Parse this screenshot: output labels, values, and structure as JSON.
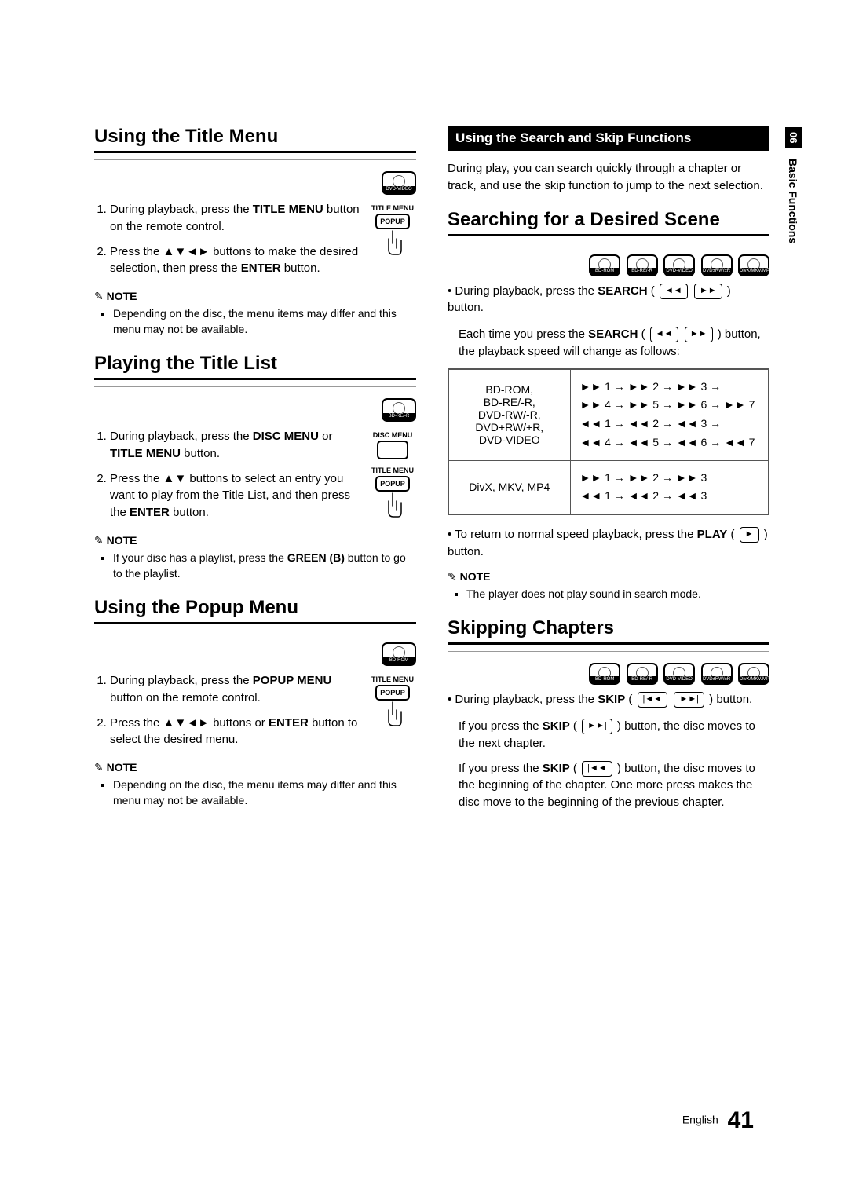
{
  "sideTab": {
    "num": "06",
    "label": "Basic Functions"
  },
  "left": {
    "s1": {
      "title": "Using the Title Menu",
      "discs": [
        "DVD-VIDEO"
      ],
      "remote": {
        "titleMenu": "TITLE MENU",
        "popup": "POPUP"
      },
      "step1_a": "During playback, press the ",
      "step1_b": "TITLE MENU",
      "step1_c": " button on the remote control.",
      "step2_a": "Press the ▲▼◄► buttons to make the desired selection, then press the ",
      "step2_b": "ENTER",
      "step2_c": " button.",
      "noteLabel": "NOTE",
      "note1": "Depending on the disc, the menu items may differ and this menu may not be available."
    },
    "s2": {
      "title": "Playing the Title List",
      "discs": [
        "BD-RE/-R"
      ],
      "remote": {
        "discMenu": "DISC MENU",
        "titleMenu": "TITLE MENU",
        "popup": "POPUP"
      },
      "step1_a": "During playback, press the ",
      "step1_b": "DISC MENU",
      "step1_c": " or ",
      "step1_d": "TITLE MENU",
      "step1_e": " button.",
      "step2_a": "Press the ▲▼ buttons to select an entry you want to play from the Title List, and then press the ",
      "step2_b": "ENTER",
      "step2_c": " button.",
      "noteLabel": "NOTE",
      "note1_a": "If your disc has a playlist, press the ",
      "note1_b": "GREEN (B)",
      "note1_c": " button to go to the playlist."
    },
    "s3": {
      "title": "Using the Popup Menu",
      "discs": [
        "BD-ROM"
      ],
      "remote": {
        "titleMenu": "TITLE MENU",
        "popup": "POPUP"
      },
      "step1_a": "During playback, press the ",
      "step1_b": "POPUP MENU",
      "step1_c": " button on the remote control.",
      "step2_a": "Press the ▲▼◄► buttons or ",
      "step2_b": "ENTER",
      "step2_c": " button to select the desired menu.",
      "noteLabel": "NOTE",
      "note1": "Depending on the disc, the menu items may differ and this menu may not be available."
    }
  },
  "right": {
    "bar": "Using the Search and Skip Functions",
    "intro": "During play, you can search quickly through a chapter or track, and use the skip function to jump to the next selection.",
    "s1": {
      "title": "Searching for a Desired Scene",
      "discs": [
        "BD-ROM",
        "BD-RE/-R",
        "DVD-VIDEO",
        "DVD±RW/±R",
        "DivX/MKV/MP4"
      ],
      "p1_a": "During playback, press the ",
      "p1_b": "SEARCH",
      "p1_c": " ( ",
      "p1_d": " ) button.",
      "p2_a": "Each time you press the ",
      "p2_b": "SEARCH",
      "p2_c": " ( ",
      "p2_d": " ) button, the playback speed will change as follows:",
      "table": {
        "r1": {
          "left": "BD-ROM,\nBD-RE/-R,\nDVD-RW/-R,\nDVD+RW/+R,\nDVD-VIDEO",
          "right": "►► 1 → ►► 2 → ►► 3 →\n►► 4 → ►► 5 → ►► 6 → ►► 7\n◄◄ 1 → ◄◄ 2 → ◄◄ 3 →\n◄◄ 4 → ◄◄ 5 → ◄◄ 6 → ◄◄ 7"
        },
        "r2": {
          "left": "DivX, MKV, MP4",
          "right": "►► 1 → ►► 2 → ►► 3\n◄◄ 1 → ◄◄ 2 → ◄◄ 3"
        }
      },
      "p3_a": "To return to normal speed playback, press the ",
      "p3_b": "PLAY",
      "p3_c": " ( ",
      "p3_d": " ) button.",
      "noteLabel": "NOTE",
      "note1": "The player does not play sound in search mode."
    },
    "s2": {
      "title": "Skipping Chapters",
      "discs": [
        "BD-ROM",
        "BD-RE/-R",
        "DVD-VIDEO",
        "DVD±RW/±R",
        "DivX/MKV/MP4"
      ],
      "p1_a": "During playback, press the ",
      "p1_b": "SKIP",
      "p1_c": " ( ",
      "p1_d": " ) button.",
      "p2_a": "If you press the ",
      "p2_b": "SKIP",
      "p2_c": " ( ",
      "p2_d": " ) button, the disc moves to the next chapter.",
      "p3_a": "If you press the ",
      "p3_b": "SKIP",
      "p3_c": " ( ",
      "p3_d": " ) button, the disc moves to the beginning of the chapter. One more press makes the disc move to the beginning of the previous chapter."
    }
  },
  "footer": {
    "lang": "English",
    "page": "41"
  },
  "iconText": {
    "rew": "◄◄",
    "ff": "►►",
    "play": "►",
    "prev": "|◄◄",
    "next": "►►|"
  }
}
